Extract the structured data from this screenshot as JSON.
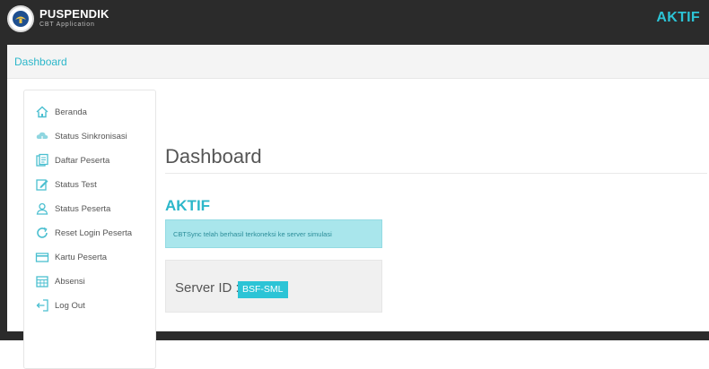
{
  "header": {
    "brand_title": "PUSPENDIK",
    "brand_subtitle": "CBT Application",
    "status": "AKTIF"
  },
  "breadcrumb": {
    "label": "Dashboard"
  },
  "sidebar": {
    "items": [
      {
        "label": "Beranda",
        "icon": "home-icon"
      },
      {
        "label": "Status Sinkronisasi",
        "icon": "cloud-sync-icon"
      },
      {
        "label": "Daftar Peserta",
        "icon": "document-list-icon"
      },
      {
        "label": "Status Test",
        "icon": "edit-icon"
      },
      {
        "label": "Status Peserta",
        "icon": "user-icon"
      },
      {
        "label": "Reset Login Peserta",
        "icon": "refresh-icon"
      },
      {
        "label": "Kartu Peserta",
        "icon": "card-icon"
      },
      {
        "label": "Absensi",
        "icon": "calendar-icon"
      },
      {
        "label": "Log Out",
        "icon": "logout-icon"
      }
    ]
  },
  "main": {
    "title": "Dashboard",
    "status_heading": "AKTIF",
    "alert_message": "CBTSync telah berhasil terkoneksi ke server simulasi",
    "server_label": "Server ID :",
    "server_id": "BSF-SML"
  },
  "colors": {
    "accent": "#2cc4d6",
    "topbar": "#2b2b2b",
    "alert_bg": "#a9e6ec",
    "panel_bg": "#f0f0f0"
  }
}
